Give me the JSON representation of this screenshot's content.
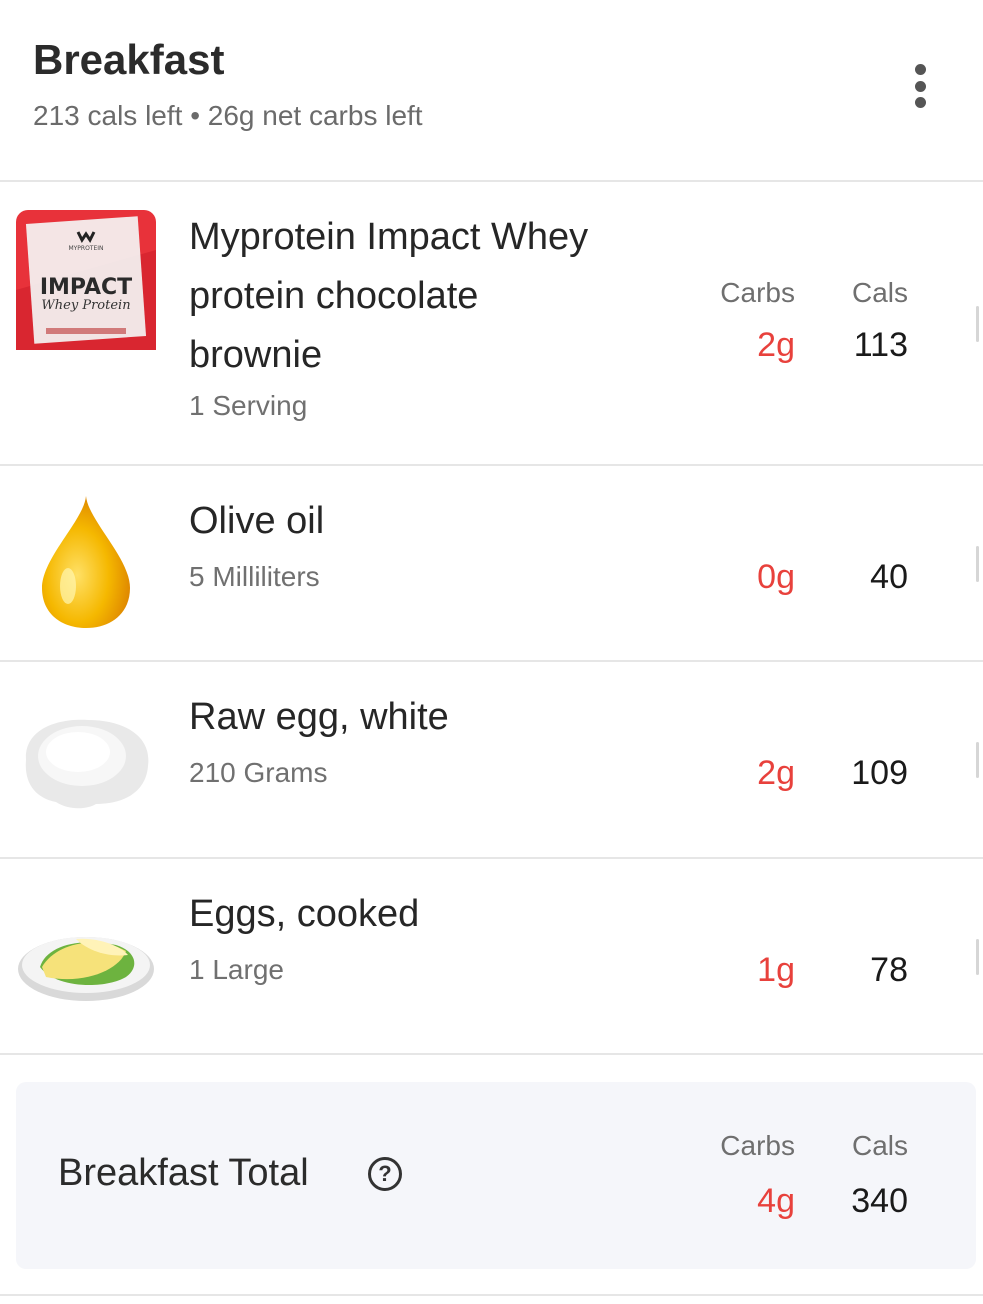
{
  "header": {
    "title": "Breakfast",
    "subtitle": "213 cals left • 26g net carbs left"
  },
  "columns": {
    "carbs": "Carbs",
    "cals": "Cals"
  },
  "items": [
    {
      "name_line1": "Myprotein Impact Whey",
      "name_line2": "protein chocolate",
      "name_line3": "brownie",
      "quantity": "1 Serving",
      "carbs": "2g",
      "cals": "113",
      "image": "myprotein-package",
      "package_brand": "MYPROTEIN",
      "package_title": "IMPACT",
      "package_sub": "Whey Protein"
    },
    {
      "name": "Olive oil",
      "quantity": "5 Milliliters",
      "carbs": "0g",
      "cals": "40",
      "image": "oil-drop-icon"
    },
    {
      "name": "Raw egg, white",
      "quantity": "210 Grams",
      "carbs": "2g",
      "cals": "109",
      "image": "egg-white-icon"
    },
    {
      "name": "Eggs, cooked",
      "quantity": "1 Large",
      "carbs": "1g",
      "cals": "78",
      "image": "omelette-plate-icon"
    }
  ],
  "total": {
    "label": "Breakfast Total",
    "carbs": "4g",
    "cals": "340"
  },
  "colors": {
    "carbs": "#e8413c",
    "total_bg": "#f5f6fa",
    "brand_red": "#e8323a"
  }
}
